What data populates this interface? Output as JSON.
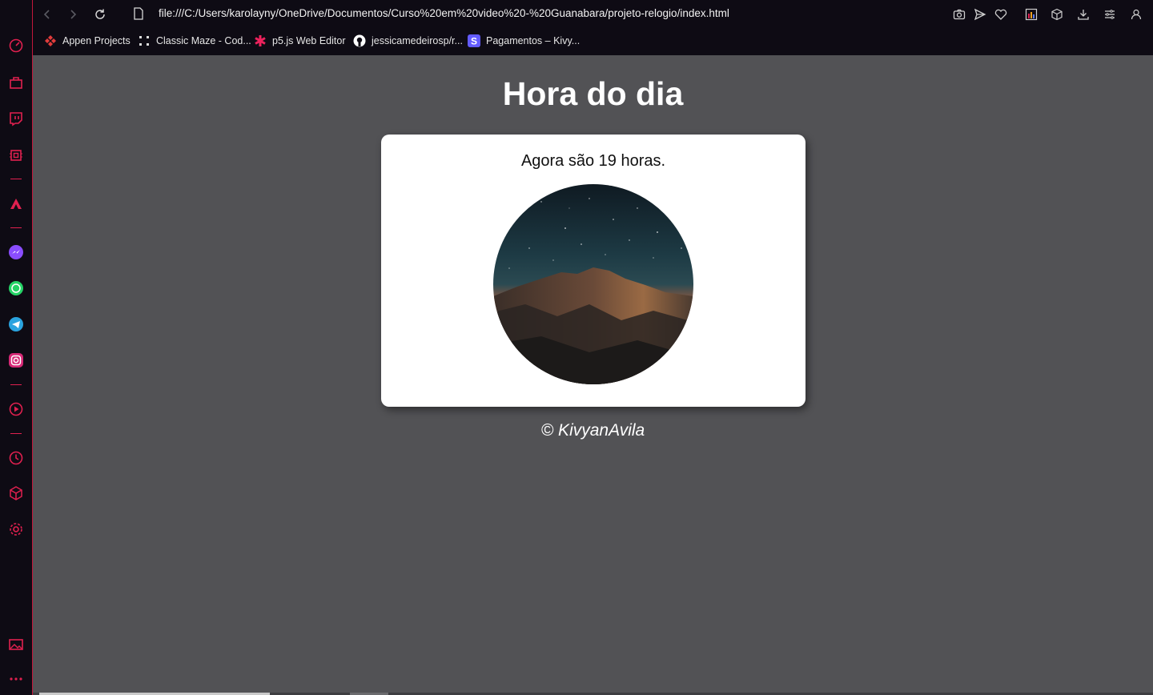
{
  "browser": {
    "url": "file:///C:/Users/karolayny/OneDrive/Documentos/Curso%20em%20video%20-%20Guanabara/projeto-relogio/index.html",
    "bookmarks": [
      {
        "label": "Appen Projects",
        "icon": "appen-icon"
      },
      {
        "label": "Classic Maze - Cod...",
        "icon": "maze-icon"
      },
      {
        "label": "p5.js Web Editor",
        "icon": "p5js-icon"
      },
      {
        "label": "jessicamedeirosp/r...",
        "icon": "github-icon"
      },
      {
        "label": "Pagamentos – Kivy...",
        "icon": "stripe-icon"
      }
    ],
    "sidebar_icons": [
      "speed-dial-icon",
      "shopping-icon",
      "twitch-icon",
      "aria-icon",
      "messenger-icon",
      "whatsapp-icon",
      "telegram-icon",
      "instagram-icon",
      "player-icon",
      "history-icon",
      "extensions-icon",
      "settings-icon",
      "gallery-icon",
      "more-icon"
    ],
    "accent_color": "#e0204f"
  },
  "page": {
    "title": "Hora do dia",
    "message": "Agora são 19 horas.",
    "image_alt": "night mountain",
    "footer": "© KivyanAvila"
  }
}
